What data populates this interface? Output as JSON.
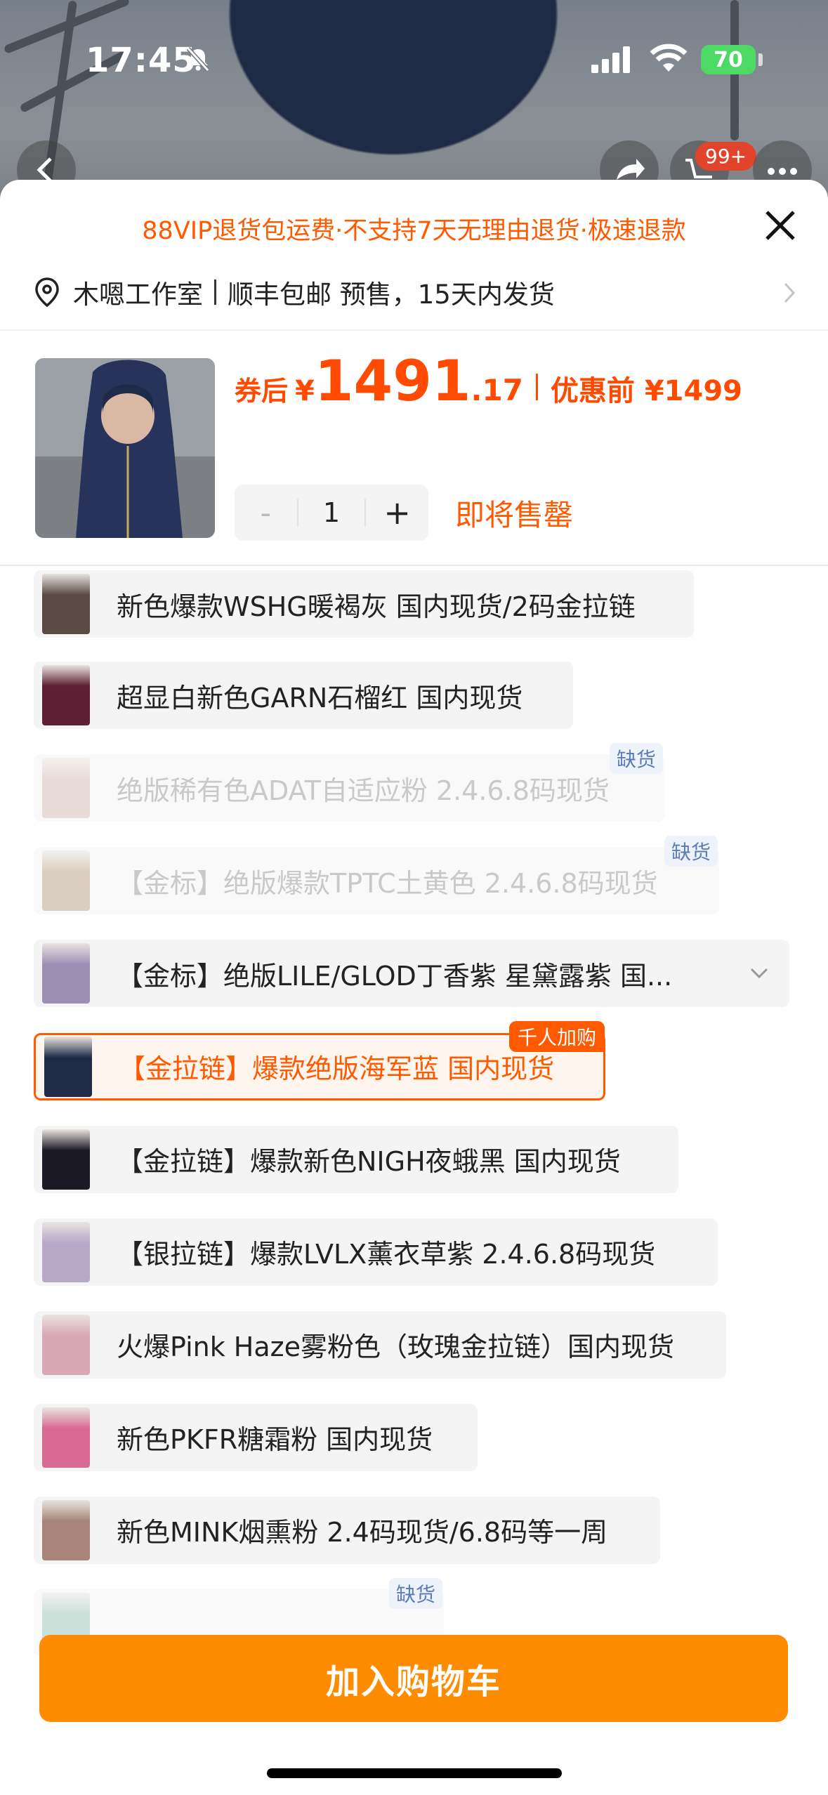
{
  "status": {
    "time": "17:45",
    "battery": "70"
  },
  "header": {
    "cart_badge": "99+"
  },
  "sheet": {
    "promo": "88VIP退货包运费·不支持7天无理由退货·极速退款",
    "shop_name": "木嗯工作室",
    "shipping": "顺丰包邮 预售，15天内发货",
    "price_after_label": "券后",
    "currency": "¥",
    "price_int": "1491",
    "price_dec": ".17",
    "price_before": "优惠前 ¥1499",
    "qty_minus": "-",
    "qty": "1",
    "qty_plus": "+",
    "stock_note": "即将售罄"
  },
  "skus": [
    {
      "label": "新色爆款WSHG暖褐灰 国内现货/2码金拉链",
      "state": "normal",
      "color": "#5a4a44"
    },
    {
      "label": "超显白新色GARN石榴红 国内现货",
      "state": "normal",
      "color": "#5c1f33"
    },
    {
      "label": "绝版稀有色ADAT自适应粉 2.4.6.8码现货",
      "state": "disabled",
      "tag": "缺货",
      "color": "#c9a59c"
    },
    {
      "label": "【金标】绝版爆款TPTC土黄色 2.4.6.8码现货",
      "state": "disabled",
      "tag": "缺货",
      "color": "#a07c58"
    },
    {
      "label": "【金标】绝版LILE/GLOD丁香紫 星黛露紫 国...",
      "state": "normal",
      "color": "#9d8fb3"
    },
    {
      "label": "【金拉链】爆款绝版海军蓝 国内现货",
      "state": "selected",
      "tag": "千人加购",
      "color": "#1f2a48"
    },
    {
      "label": "【金拉链】爆款新色NIGH夜蛾黑 国内现货",
      "state": "normal",
      "color": "#1c1a24"
    },
    {
      "label": "【银拉链】爆款LVLX薰衣草紫 2.4.6.8码现货",
      "state": "normal",
      "color": "#b8a8c8"
    },
    {
      "label": "火爆Pink Haze雾粉色（玫瑰金拉链）国内现货",
      "state": "normal",
      "color": "#d8a8b4"
    },
    {
      "label": "新色PKFR糖霜粉 国内现货",
      "state": "normal",
      "color": "#d86a94"
    },
    {
      "label": "新色MINK烟熏粉 2.4码现货/6.8码等一周",
      "state": "normal",
      "color": "#a88478"
    },
    {
      "label": "",
      "state": "disabled",
      "tag": "缺货",
      "color": "#7ab0a0"
    }
  ],
  "footer": {
    "add_to_cart": "加入购物车"
  },
  "colors": {
    "accent": "#ff5a00",
    "cart_button": "#ff8c00"
  }
}
